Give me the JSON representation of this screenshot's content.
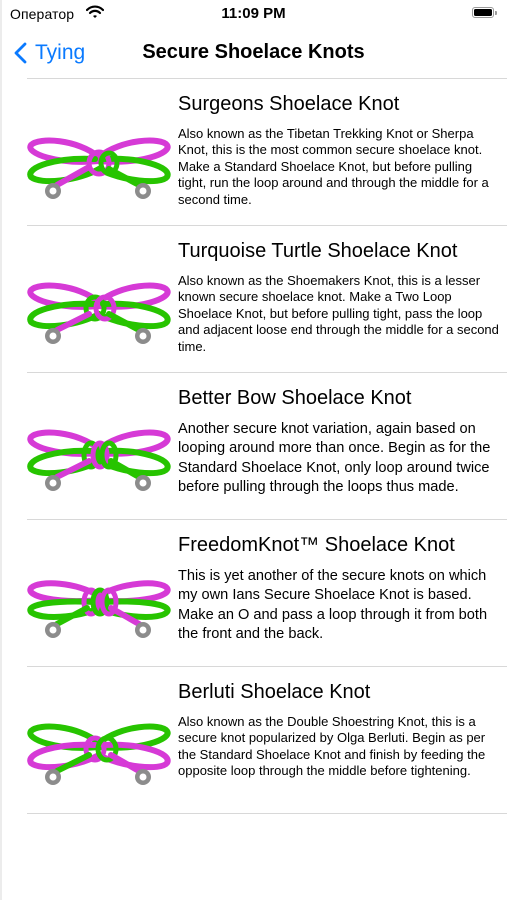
{
  "status_bar": {
    "carrier": "Оператор",
    "time": "11:09 PM"
  },
  "nav": {
    "back_label": "Tying",
    "title": "Secure Shoelace Knots"
  },
  "colors": {
    "accent": "#0a7aff",
    "lace_magenta": "#d63ad6",
    "lace_green": "#27c400",
    "eyelet": "#8c8c8c"
  },
  "knots": [
    {
      "title": "Surgeons Shoelace Knot",
      "description": "Also known as the Tibetan Trekking Knot or Sherpa Knot, this is the most common secure shoelace knot. Make a Standard Shoelace Knot, but before pulling tight, run the loop around and through the middle for a second time."
    },
    {
      "title": "Turquoise Turtle Shoelace Knot",
      "description": "Also known as the Shoemakers Knot, this is a lesser known secure shoelace knot. Make a Two Loop Shoelace Knot, but before pulling tight, pass the loop and adjacent loose end through the middle for a second time."
    },
    {
      "title": "Better Bow Shoelace Knot",
      "description": "Another secure knot variation, again based on looping around more than once. Begin as for the Standard Shoelace Knot, only loop around twice before pulling through the loops thus made."
    },
    {
      "title": "FreedomKnot™ Shoelace Knot",
      "description": "This is yet another of the secure knots on which my own Ians Secure Shoelace Knot is based. Make an O and pass a loop through it from both the front and the back."
    },
    {
      "title": "Berluti Shoelace Knot",
      "description": "Also known as the Double Shoestring Knot, this is a secure knot popularized by Olga Berluti. Begin as per the Standard Shoelace Knot and finish by feeding the opposite loop through the middle before tightening."
    }
  ]
}
